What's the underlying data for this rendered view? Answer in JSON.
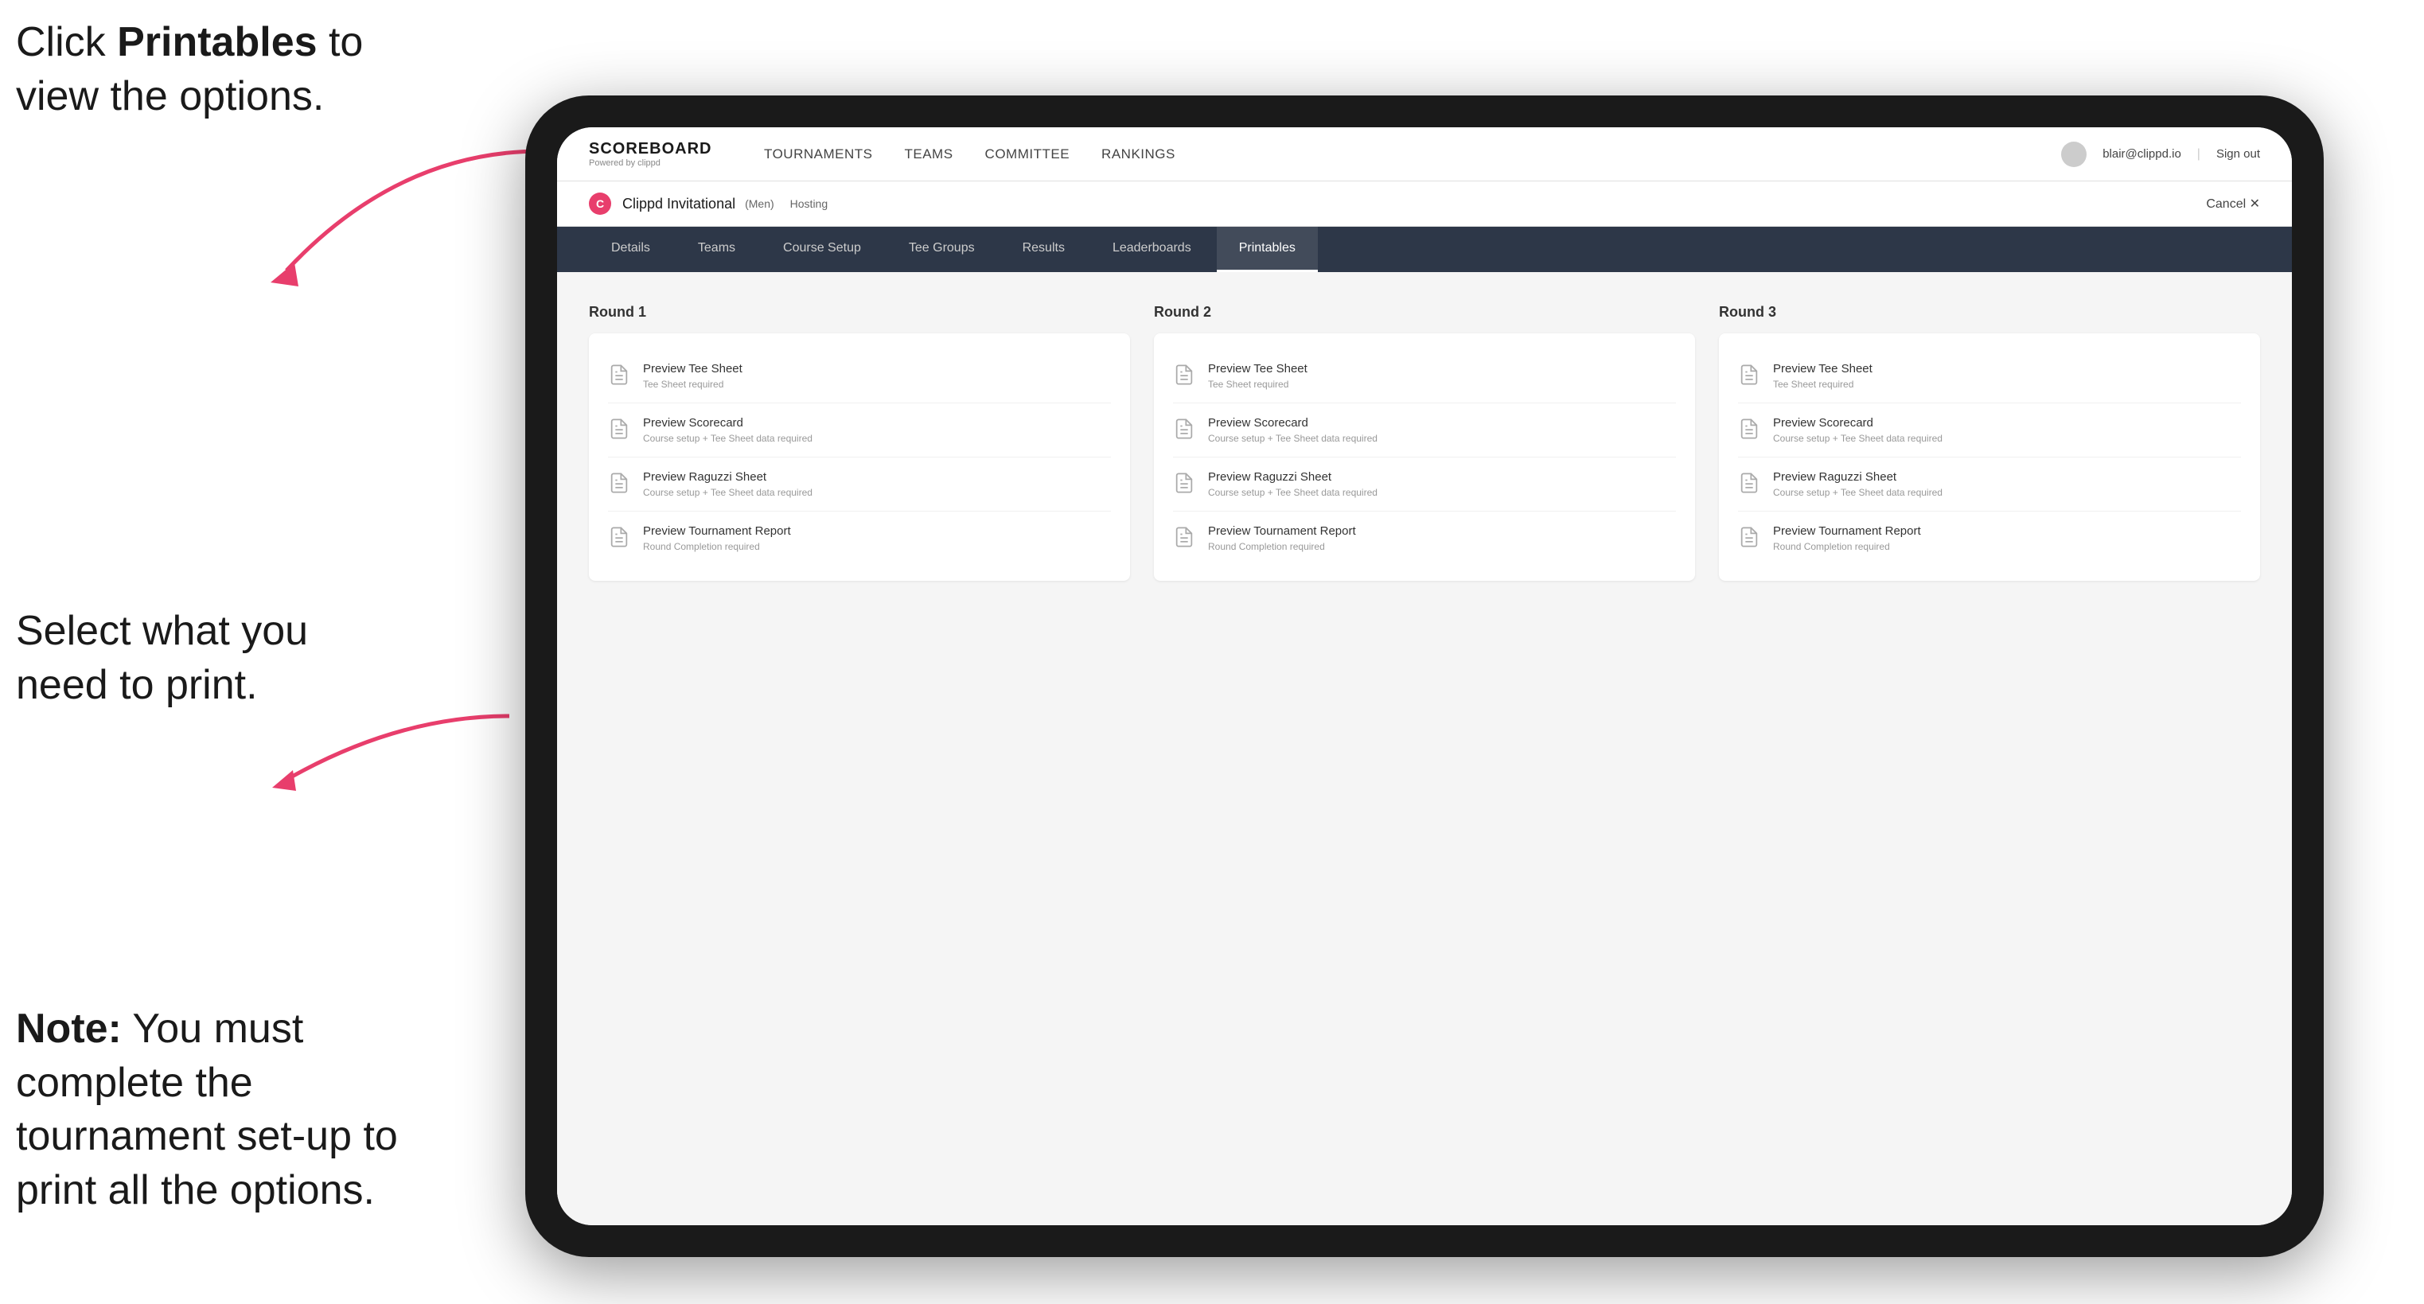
{
  "instructions": {
    "top_line1": "Click ",
    "top_bold": "Printables",
    "top_line2": " to",
    "top_line3": "view the options.",
    "middle_line1": "Select what you",
    "middle_line2": "need to print.",
    "bottom_bold": "Note:",
    "bottom_text": " You must complete the tournament set-up to print all the options."
  },
  "top_nav": {
    "brand": "SCOREBOARD",
    "brand_sub": "Powered by clippd",
    "items": [
      "TOURNAMENTS",
      "TEAMS",
      "COMMITTEE",
      "RANKINGS"
    ],
    "user_email": "blair@clippd.io",
    "sign_out": "Sign out"
  },
  "tournament_bar": {
    "logo_letter": "C",
    "name": "Clippd Invitational",
    "tag": "(Men)",
    "hosting": "Hosting",
    "cancel": "Cancel ✕"
  },
  "sub_nav": {
    "tabs": [
      "Details",
      "Teams",
      "Course Setup",
      "Tee Groups",
      "Results",
      "Leaderboards",
      "Printables"
    ],
    "active": "Printables"
  },
  "rounds": [
    {
      "title": "Round 1",
      "items": [
        {
          "title": "Preview Tee Sheet",
          "sub": "Tee Sheet required"
        },
        {
          "title": "Preview Scorecard",
          "sub": "Course setup + Tee Sheet data required"
        },
        {
          "title": "Preview Raguzzi Sheet",
          "sub": "Course setup + Tee Sheet data required"
        },
        {
          "title": "Preview Tournament Report",
          "sub": "Round Completion required"
        }
      ]
    },
    {
      "title": "Round 2",
      "items": [
        {
          "title": "Preview Tee Sheet",
          "sub": "Tee Sheet required"
        },
        {
          "title": "Preview Scorecard",
          "sub": "Course setup + Tee Sheet data required"
        },
        {
          "title": "Preview Raguzzi Sheet",
          "sub": "Course setup + Tee Sheet data required"
        },
        {
          "title": "Preview Tournament Report",
          "sub": "Round Completion required"
        }
      ]
    },
    {
      "title": "Round 3",
      "items": [
        {
          "title": "Preview Tee Sheet",
          "sub": "Tee Sheet required"
        },
        {
          "title": "Preview Scorecard",
          "sub": "Course setup + Tee Sheet data required"
        },
        {
          "title": "Preview Raguzzi Sheet",
          "sub": "Course setup + Tee Sheet data required"
        },
        {
          "title": "Preview Tournament Report",
          "sub": "Round Completion required"
        }
      ]
    }
  ]
}
